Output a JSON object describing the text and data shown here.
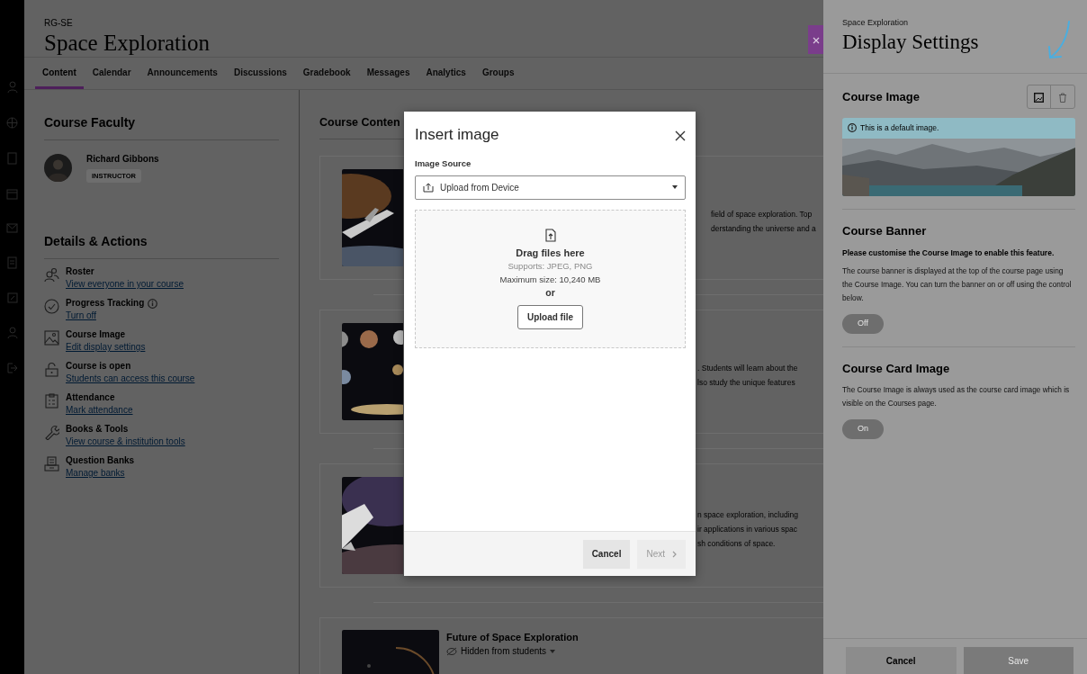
{
  "course": {
    "code": "RG-SE",
    "title": "Space Exploration"
  },
  "tabs": [
    {
      "label": "Content",
      "selected": true
    },
    {
      "label": "Calendar",
      "selected": false
    },
    {
      "label": "Announcements",
      "selected": false
    },
    {
      "label": "Discussions",
      "selected": false
    },
    {
      "label": "Gradebook",
      "selected": false
    },
    {
      "label": "Messages",
      "selected": false
    },
    {
      "label": "Analytics",
      "selected": false
    },
    {
      "label": "Groups",
      "selected": false
    }
  ],
  "faculty": {
    "heading": "Course Faculty",
    "members": [
      {
        "name": "Richard Gibbons",
        "role": "INSTRUCTOR"
      }
    ]
  },
  "details": {
    "heading": "Details & Actions",
    "items": [
      {
        "title": "Roster",
        "link": "View everyone in your course",
        "info": false
      },
      {
        "title": "Progress Tracking",
        "link": "Turn off",
        "info": true
      },
      {
        "title": "Course Image",
        "link": "Edit display settings",
        "info": false
      },
      {
        "title": "Course is open",
        "link": "Students can access this course",
        "info": false
      },
      {
        "title": "Attendance",
        "link": "Mark attendance",
        "info": false
      },
      {
        "title": "Books & Tools",
        "link": "View course & institution tools",
        "info": false
      },
      {
        "title": "Question Banks",
        "link": "Manage banks",
        "info": false
      }
    ]
  },
  "content": {
    "heading": "Course Conten",
    "items": [
      {
        "kind": "snippet",
        "lines": [
          "field of space exploration. Top",
          "derstanding the universe and a"
        ]
      },
      {
        "kind": "snippet",
        "lines": [
          ". Students will learn about the",
          "lso study the unique features"
        ]
      },
      {
        "kind": "snippet",
        "lines": [
          "n space exploration, including",
          "ir applications in various spac",
          "sh conditions of space."
        ]
      },
      {
        "kind": "titled",
        "title": "Future of Space Exploration",
        "visibility": "Hidden from students"
      }
    ]
  },
  "dialog": {
    "title": "Insert image",
    "source_label": "Image Source",
    "source_value": "Upload from Device",
    "drop_title": "Drag files here",
    "supports": "Supports: JPEG, PNG",
    "max_size": "Maximum size: 10,240 MB",
    "or": "or",
    "upload_button": "Upload file",
    "buttons": [
      {
        "label": "Cancel",
        "disabled": false
      },
      {
        "label": "Next",
        "disabled": true
      }
    ]
  },
  "panel": {
    "subtitle": "Space Exploration",
    "title": "Display Settings",
    "image_section": {
      "heading": "Course Image",
      "notice": "This is a default image."
    },
    "banner_section": {
      "heading": "Course Banner",
      "warning": "Please customise the Course Image to enable this feature.",
      "text": "The course banner is displayed at the top of the course page using the Course Image. You can turn the banner on or off using the control below.",
      "toggle": "Off"
    },
    "card_section": {
      "heading": "Course Card Image",
      "text": "The Course Image is always used as the course card image which is visible on the Courses page.",
      "toggle": "On"
    },
    "buttons": [
      {
        "label": "Cancel",
        "disabled": false
      },
      {
        "label": "Save",
        "disabled": true
      }
    ]
  }
}
